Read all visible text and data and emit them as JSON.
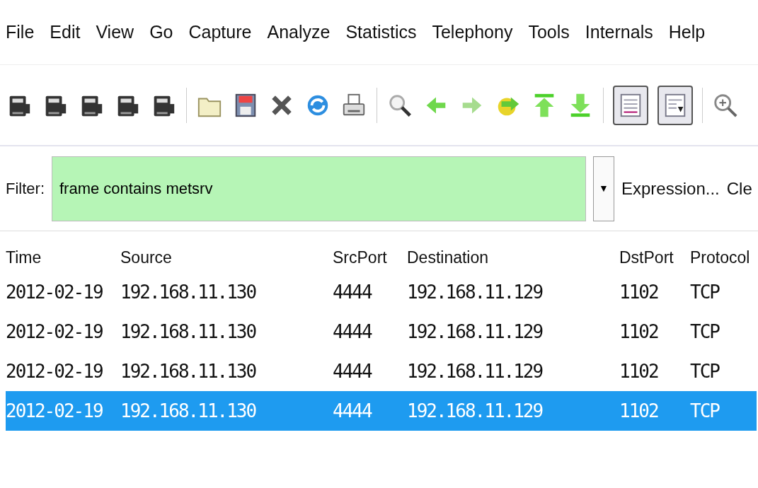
{
  "menu": [
    {
      "label": "File"
    },
    {
      "label": "Edit"
    },
    {
      "label": "View"
    },
    {
      "label": "Go"
    },
    {
      "label": "Capture"
    },
    {
      "label": "Analyze"
    },
    {
      "label": "Statistics"
    },
    {
      "label": "Telephony"
    },
    {
      "label": "Tools"
    },
    {
      "label": "Internals"
    },
    {
      "label": "Help"
    }
  ],
  "toolbar": [
    {
      "kind": "card"
    },
    {
      "kind": "card"
    },
    {
      "kind": "card"
    },
    {
      "kind": "card"
    },
    {
      "kind": "card"
    },
    {
      "kind": "sep"
    },
    {
      "kind": "folder"
    },
    {
      "kind": "disk"
    },
    {
      "kind": "close"
    },
    {
      "kind": "reload"
    },
    {
      "kind": "printer"
    },
    {
      "kind": "sep"
    },
    {
      "kind": "search"
    },
    {
      "kind": "left"
    },
    {
      "kind": "right"
    },
    {
      "kind": "jump"
    },
    {
      "kind": "top"
    },
    {
      "kind": "bottom"
    },
    {
      "kind": "sep"
    },
    {
      "kind": "toggle",
      "pressed": true
    },
    {
      "kind": "toggle2",
      "pressed": true
    },
    {
      "kind": "sep"
    },
    {
      "kind": "zoom"
    }
  ],
  "filter": {
    "label": "Filter:",
    "value": "frame contains metsrv",
    "dropdown": "▼",
    "expression": "Expression...",
    "clear": "Cle"
  },
  "table": {
    "columns": [
      "Time",
      "Source",
      "SrcPort",
      "Destination",
      "DstPort",
      "Protocol"
    ],
    "rows": [
      {
        "cells": [
          "2012-02-19",
          "192.168.11.130",
          "4444",
          "192.168.11.129",
          "1102",
          "TCP"
        ],
        "selected": false
      },
      {
        "cells": [
          "2012-02-19",
          "192.168.11.130",
          "4444",
          "192.168.11.129",
          "1102",
          "TCP"
        ],
        "selected": false
      },
      {
        "cells": [
          "2012-02-19",
          "192.168.11.130",
          "4444",
          "192.168.11.129",
          "1102",
          "TCP"
        ],
        "selected": false
      },
      {
        "cells": [
          "2012-02-19",
          "192.168.11.130",
          "4444",
          "192.168.11.129",
          "1102",
          "TCP"
        ],
        "selected": true
      }
    ]
  }
}
